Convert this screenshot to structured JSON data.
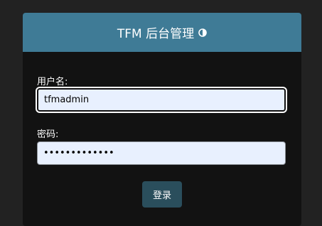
{
  "header": {
    "title": "TFM 后台管理",
    "icon": "contrast-icon"
  },
  "form": {
    "username_label": "用户名:",
    "username_value": "tfmadmin",
    "password_label": "密码:",
    "password_value": "•••••••••••••",
    "submit_label": "登录"
  },
  "colors": {
    "header_bg": "#3f7b96",
    "card_bg": "#121212",
    "page_bg": "#222222",
    "input_bg": "#e8f0fe",
    "button_bg": "#2a4e5c"
  }
}
